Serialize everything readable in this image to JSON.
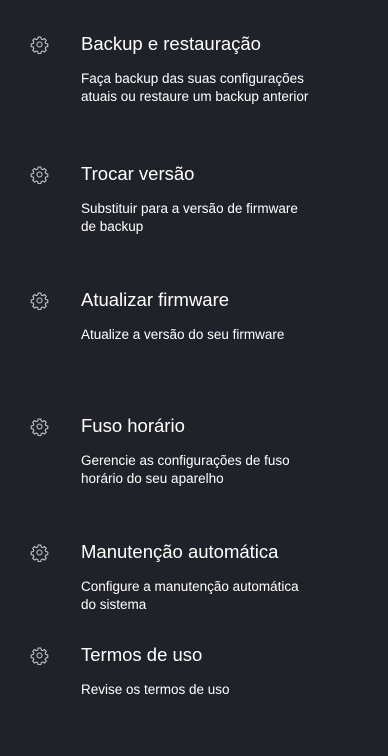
{
  "colors": {
    "background": "#1f2229",
    "text": "#ffffff",
    "icon": "#c9ccd1"
  },
  "menu": {
    "items": [
      {
        "icon": "gear-icon",
        "title": "Backup e restauração",
        "description": "Faça backup das suas configurações\natuais ou restaure um backup anterior"
      },
      {
        "icon": "gear-icon",
        "title": "Trocar versão",
        "description": "Substituir para a versão de firmware\nde backup"
      },
      {
        "icon": "gear-icon",
        "title": "Atualizar firmware",
        "description": "Atualize a versão do seu firmware"
      },
      {
        "icon": "gear-icon",
        "title": "Fuso horário",
        "description": "Gerencie as configurações de fuso\nhorário do seu aparelho"
      },
      {
        "icon": "gear-icon",
        "title": "Manutenção automática",
        "description": "Configure a manutenção automática\ndo sistema"
      },
      {
        "icon": "gear-icon",
        "title": "Termos de uso",
        "description": "Revise os termos de uso"
      }
    ]
  }
}
